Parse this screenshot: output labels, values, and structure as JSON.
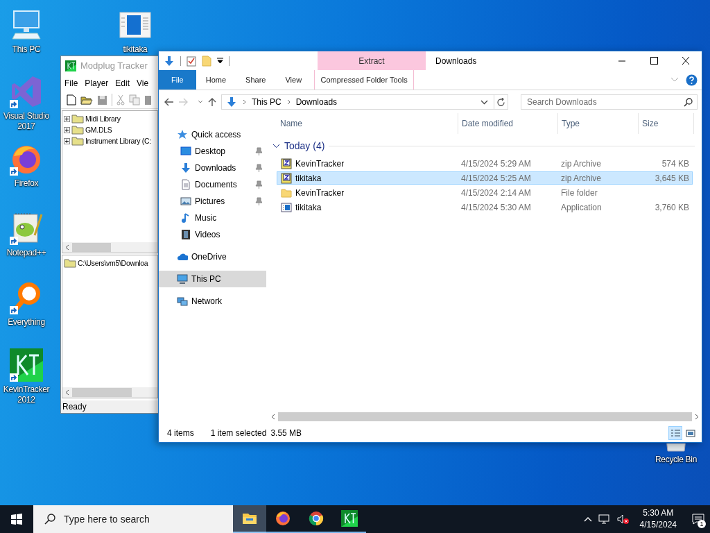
{
  "desktop_icons": [
    {
      "label": "This PC",
      "kind": "pc",
      "shortcut": false
    },
    {
      "label": "tikitaka",
      "kind": "app",
      "shortcut": false
    },
    {
      "label": "Visual Studio 2017",
      "kind": "vs",
      "shortcut": true
    },
    {
      "label": "Firefox",
      "kind": "firefox",
      "shortcut": true
    },
    {
      "label": "Notepad++",
      "kind": "notepad",
      "shortcut": true
    },
    {
      "label": "Everything",
      "kind": "everything",
      "shortcut": true
    },
    {
      "label": "KevinTracker 2012",
      "kind": "kt",
      "shortcut": true
    },
    {
      "label": "Recycle Bin",
      "kind": "recycle",
      "shortcut": false
    }
  ],
  "modplug": {
    "title": "Modplug Tracker",
    "menu": [
      "File",
      "Player",
      "Edit",
      "Vie"
    ],
    "tree": [
      {
        "label": "Midi Library",
        "expanded": false
      },
      {
        "label": "GM.DLS",
        "expanded": false
      },
      {
        "label": "Instrument Library (C:",
        "expanded": false
      }
    ],
    "path": "C:\\Users\\vm5\\Downloa",
    "status": "Ready"
  },
  "explorer": {
    "title": "Downloads",
    "context_header": "Extract",
    "tabs": [
      {
        "label": "File",
        "kind": "file",
        "selected": false
      },
      {
        "label": "Home",
        "kind": "tab",
        "selected": false
      },
      {
        "label": "Share",
        "kind": "tab",
        "selected": false
      },
      {
        "label": "View",
        "kind": "tab",
        "selected": false
      },
      {
        "label": "Compressed Folder Tools",
        "kind": "contextual",
        "selected": false
      }
    ],
    "address": [
      "This PC",
      "Downloads"
    ],
    "search": {
      "placeholder": "Search Downloads"
    },
    "nav": [
      {
        "label": "Quick access",
        "kind": "star",
        "selected": false,
        "children": [
          {
            "label": "Desktop",
            "kind": "desktop",
            "pinned": true,
            "selected": false
          },
          {
            "label": "Downloads",
            "kind": "download",
            "pinned": true,
            "selected": false
          },
          {
            "label": "Documents",
            "kind": "document",
            "pinned": true,
            "selected": false
          },
          {
            "label": "Pictures",
            "kind": "pictures",
            "pinned": true,
            "selected": false
          },
          {
            "label": "Music",
            "kind": "music",
            "pinned": false,
            "selected": false
          },
          {
            "label": "Videos",
            "kind": "videos",
            "pinned": false,
            "selected": false
          }
        ]
      },
      {
        "label": "OneDrive",
        "kind": "cloud",
        "selected": false
      },
      {
        "label": "This PC",
        "kind": "pc",
        "selected": true
      },
      {
        "label": "Network",
        "kind": "network",
        "selected": false
      }
    ],
    "columns": [
      "Name",
      "Date modified",
      "Type",
      "Size"
    ],
    "group": {
      "label": "Today (4)",
      "expanded": true
    },
    "rows": [
      {
        "name": "KevinTracker",
        "date": "4/15/2024 5:29 AM",
        "type": "zip Archive",
        "size": "574 KB",
        "kind": "zip",
        "selected": false
      },
      {
        "name": "tikitaka",
        "date": "4/15/2024 5:25 AM",
        "type": "zip Archive",
        "size": "3,645 KB",
        "kind": "zip",
        "selected": true
      },
      {
        "name": "KevinTracker",
        "date": "4/15/2024 2:14 AM",
        "type": "File folder",
        "kind": "folder",
        "selected": false
      },
      {
        "name": "tikitaka",
        "date": "4/15/2024 5:30 AM",
        "type": "Application",
        "size": "3,760 KB",
        "kind": "app",
        "selected": false
      }
    ],
    "status": [
      "4 items",
      "1 item selected",
      "3.55 MB"
    ],
    "views": [
      {
        "kind": "details",
        "selected": true
      },
      {
        "kind": "large",
        "selected": false
      }
    ]
  },
  "taskbar": {
    "search": {
      "placeholder": "Type here to search"
    },
    "apps": [
      {
        "kind": "explorer",
        "active": true
      },
      {
        "kind": "firefox",
        "active": false
      },
      {
        "kind": "chrome",
        "active": false
      },
      {
        "kind": "kt",
        "active": false
      }
    ],
    "time": "5:30 AM",
    "date": "4/15/2024",
    "notifications": "1"
  }
}
